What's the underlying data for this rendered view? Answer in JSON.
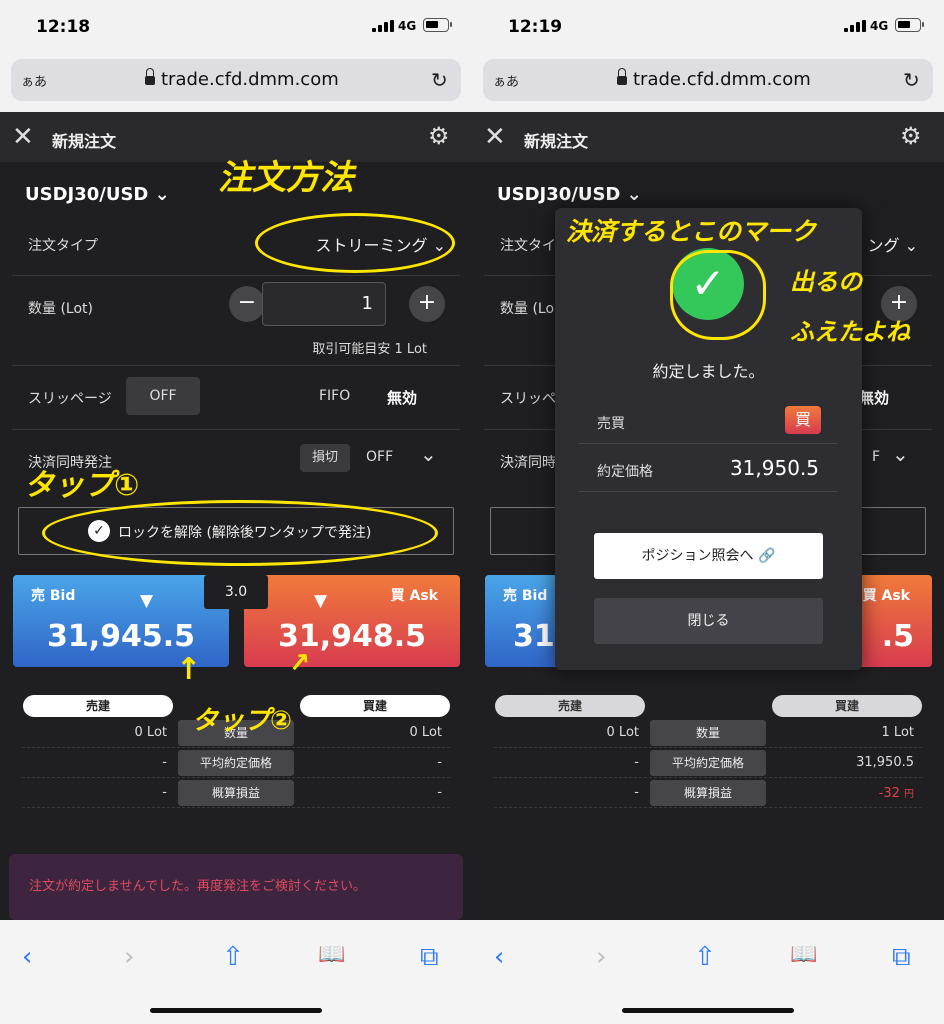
{
  "colors": {
    "accent_blue": "#2f7df6",
    "bid_blue": "#3a85dc",
    "ask_red": "#e04a4a",
    "annotation_yellow": "#ffe600",
    "success_green": "#34c759",
    "error_red": "#e04a5e"
  },
  "left": {
    "status": {
      "time": "12:18",
      "network": "4G"
    },
    "browser": {
      "aa": "ぁあ",
      "url": "trade.cfd.dmm.com"
    },
    "header": {
      "close": "✕",
      "title": "新規注文",
      "settings": "⚙"
    },
    "symbol": "USDJ30/USD ⌄",
    "order_type": {
      "label": "注文タイプ",
      "value": "ストリーミング ⌄"
    },
    "quantity": {
      "label": "数量 (Lot)",
      "minus": "−",
      "value": "1",
      "plus": "+",
      "available": "取引可能目安 1 Lot"
    },
    "slippage": {
      "label": "スリッページ",
      "value": "OFF",
      "fifo_label": "FIFO",
      "fifo_value": "無効"
    },
    "settlement": {
      "label": "決済同時発注",
      "stop_tag": "損切",
      "value": "OFF",
      "chevron": "⌄"
    },
    "unlock": {
      "check": "✓",
      "text": "ロックを解除 (解除後ワンタップで発注)"
    },
    "bid": {
      "label": "売 Bid",
      "arrow": "▼",
      "price": "31,945.5"
    },
    "spread": "3.0",
    "ask": {
      "label": "買 Ask",
      "arrow": "▼",
      "price": "31,948.5"
    },
    "positions": {
      "sell_header": "売建",
      "buy_header": "買建",
      "rows": [
        {
          "label": "数量",
          "sell": "0 Lot",
          "buy": "0 Lot"
        },
        {
          "label": "平均約定価格",
          "sell": "-",
          "buy": "-"
        },
        {
          "label": "概算損益",
          "sell": "-",
          "buy": "-"
        }
      ]
    },
    "error": "注文が約定しませんでした。再度発注をご検討ください。",
    "annotations": {
      "order_method": "注文方法",
      "tap1": "タップ①",
      "tap2": "タップ②",
      "arrow": "↑"
    }
  },
  "right": {
    "status": {
      "time": "12:19",
      "network": "4G"
    },
    "browser": {
      "aa": "ぁあ",
      "url": "trade.cfd.dmm.com"
    },
    "header": {
      "close": "✕",
      "title": "新規注文",
      "settings": "⚙"
    },
    "symbol": "USDJ30/USD ⌄",
    "bg_fragments": {
      "order_type": "注文タイ",
      "order_type_end": "ング ⌄",
      "qty": "数量 (Lo",
      "plus": "+",
      "slip": "スリッペ",
      "fifo_value": "無効",
      "settle": "決済同時",
      "off_end": "F",
      "chev": "⌄",
      "bid": "売 Bid",
      "bid_price": "31",
      "ask": "買 Ask",
      "ask_price": ".5"
    },
    "modal": {
      "check": "✓",
      "message": "約定しました。",
      "side_label": "売買",
      "side_value": "買",
      "price_label": "約定価格",
      "price_value": "31,950.5",
      "position_button": "ポジション照会へ 🔗",
      "close_button": "閉じる"
    },
    "positions": {
      "sell_header": "売建",
      "buy_header": "買建",
      "rows": [
        {
          "label": "数量",
          "sell": "0 Lot",
          "buy": "1 Lot"
        },
        {
          "label": "平均約定価格",
          "sell": "-",
          "buy": "31,950.5"
        },
        {
          "label": "概算損益",
          "sell": "-",
          "buy": "-32",
          "buy_unit": "円"
        }
      ]
    },
    "annotations": {
      "line1": "決済するとこのマーク",
      "line2": "出るの",
      "line3": "ふえたよね"
    }
  },
  "toolbar": {
    "back": "‹",
    "forward": "›",
    "share": "⇧",
    "bookmarks": "📖",
    "tabs": "⧉"
  }
}
